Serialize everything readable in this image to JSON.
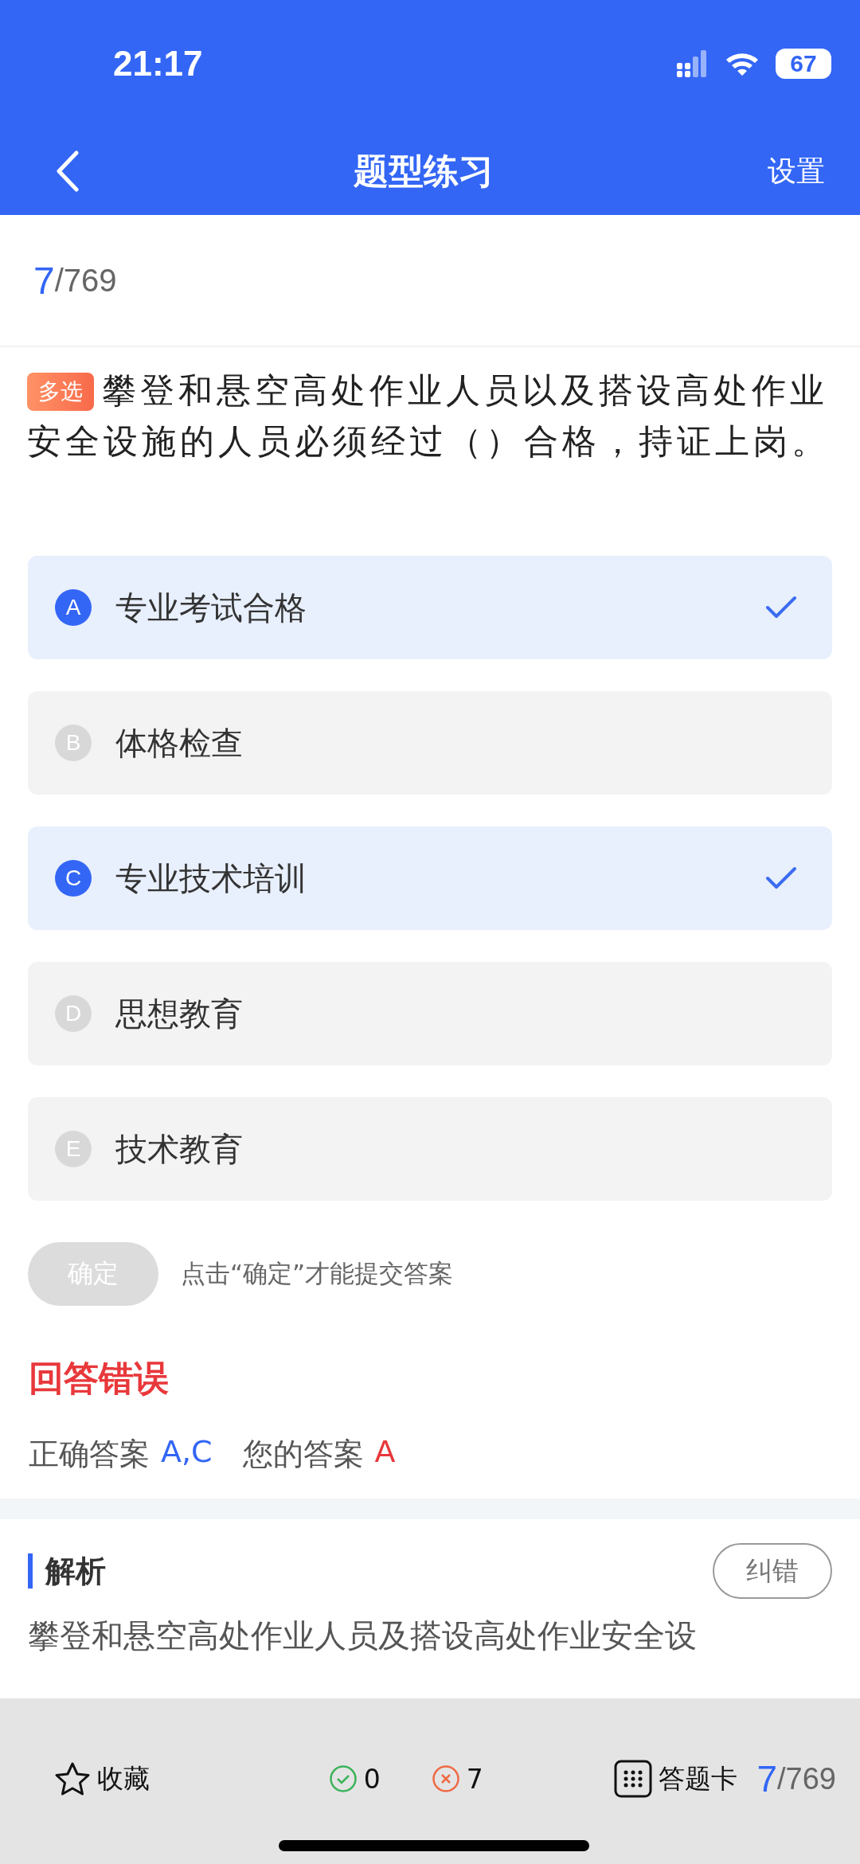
{
  "status_bar": {
    "time": "21:17",
    "battery": "67"
  },
  "nav": {
    "title": "题型练习",
    "action": "设置"
  },
  "progress": {
    "current": "7",
    "total": "/769"
  },
  "question": {
    "tag": "多选",
    "text": "攀登和悬空高处作业人员以及搭设高处作业安全设施的人员必须经过（）合格，持证上岗。"
  },
  "options": [
    {
      "letter": "A",
      "text": "专业考试合格",
      "selected": true
    },
    {
      "letter": "B",
      "text": "体格检查",
      "selected": false
    },
    {
      "letter": "C",
      "text": "专业技术培训",
      "selected": true
    },
    {
      "letter": "D",
      "text": "思想教育",
      "selected": false
    },
    {
      "letter": "E",
      "text": "技术教育",
      "selected": false
    }
  ],
  "submit": {
    "label": "确定",
    "disabled": true,
    "hint": "点击“确定”才能提交答案"
  },
  "result": {
    "title": "回答错误",
    "correct_label": "正确答案",
    "correct": "A,C",
    "yours_label": "您的答案",
    "yours": "A"
  },
  "analysis": {
    "title": "解析",
    "button": "纠错",
    "text": "攀登和悬空高处作业人员及搭设高处作业安全设"
  },
  "bottom_bar": {
    "favorite": "收藏",
    "right_count": "0",
    "wrong_count": "7",
    "card": "答题卡",
    "current": "7",
    "total": "/769"
  }
}
